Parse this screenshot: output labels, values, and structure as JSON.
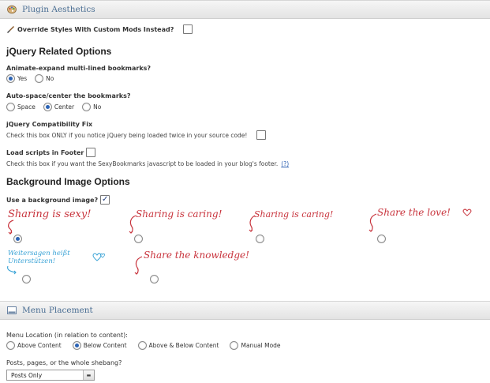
{
  "aesthetics": {
    "panel_title": "Plugin Aesthetics",
    "override_label": "Override Styles With Custom Mods Instead?",
    "jquery_title": "jQuery Related Options",
    "animate": {
      "label": "Animate-expand multi-lined bookmarks?",
      "yes": "Yes",
      "no": "No",
      "selected": "Yes"
    },
    "autospace": {
      "label": "Auto-space/center the bookmarks?",
      "space": "Space",
      "center": "Center",
      "no": "No",
      "selected": "Center"
    },
    "compat": {
      "label": "jQuery Compatibility Fix",
      "help": "Check this box ONLY if you notice jQuery being loaded twice in your source code!"
    },
    "footer": {
      "label": "Load scripts in Footer",
      "help": "Check this box if you want the SexyBookmarks javascript to be loaded in your blog's footer.",
      "help_link": "(?)"
    },
    "bg_title": "Background Image Options",
    "bg_use_label": "Use a background image?",
    "backgrounds": [
      {
        "text": "Sharing is sexy!",
        "selected": true
      },
      {
        "text": "Sharing is caring!",
        "selected": false
      },
      {
        "text": "Sharing is caring!",
        "selected": false
      },
      {
        "text": "Share the love!",
        "selected": false
      },
      {
        "text": "Weitersagen heißt Unterstützen!",
        "selected": false
      },
      {
        "text": "Share the knowledge!",
        "selected": false
      }
    ]
  },
  "placement": {
    "panel_title": "Menu Placement",
    "location_label": "Menu Location (in relation to content):",
    "locations": [
      "Above Content",
      "Below Content",
      "Above & Below Content",
      "Manual Mode"
    ],
    "location_selected": "Below Content",
    "shebang_label": "Posts, pages, or the whole shebang?",
    "shebang_value": "Posts Only"
  },
  "colors": {
    "script_red": "#c8333c",
    "header_blue": "#4a6e93",
    "radio_blue": "#2b63b5"
  }
}
